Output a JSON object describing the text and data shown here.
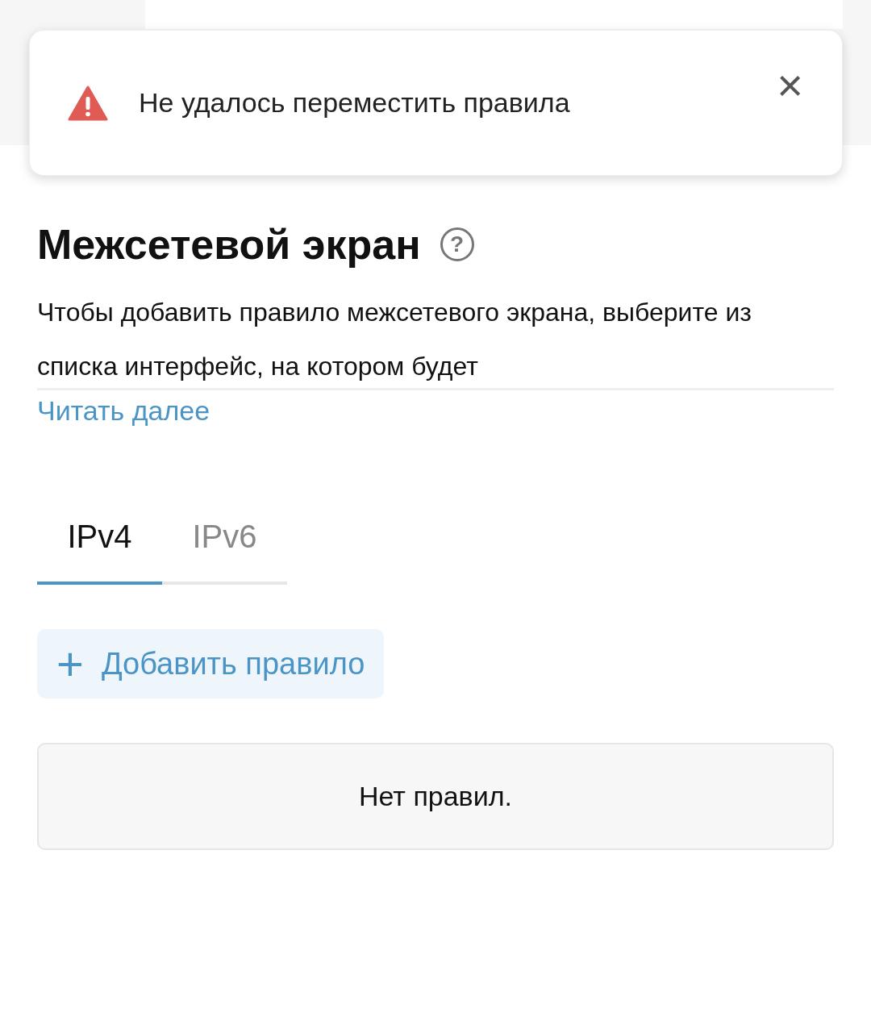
{
  "toast": {
    "message": "Не удалось переместить правила",
    "close": "×"
  },
  "header": {
    "title": "Межсетевой экран",
    "help": "?"
  },
  "description": {
    "text": "Чтобы добавить правило межсетевого экрана, выберите из списка интерфейс, на котором будет",
    "more_link": "Читать далее"
  },
  "tabs": [
    {
      "label": "IPv4",
      "selected": true
    },
    {
      "label": "IPv6",
      "selected": false
    }
  ],
  "add_button": {
    "icon": "+",
    "label": "Добавить правило"
  },
  "rules": {
    "empty_text": "Нет правил."
  }
}
